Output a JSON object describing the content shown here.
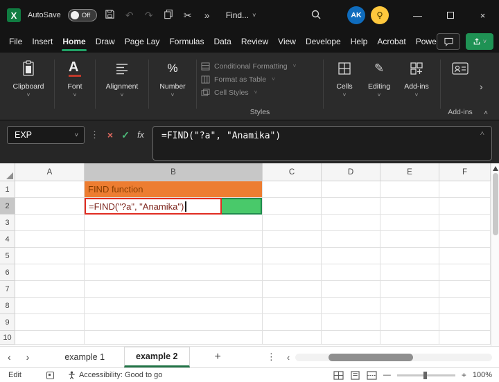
{
  "glyphs": {
    "chevron_down": "˅",
    "chevron_up": "˄",
    "chevron_left": "‹",
    "chevron_right": "›",
    "more": "»",
    "ellipsis_vertical": "⋮",
    "close": "×",
    "check": "✓",
    "minus": "—",
    "plus": "+",
    "undo": "↶",
    "redo": "↷",
    "cut": "✂",
    "pencil": "✎"
  },
  "titlebar": {
    "autosave_label": "AutoSave",
    "autosave_state": "Off",
    "find_label": "Find...",
    "avatar_initials": "AK"
  },
  "menu": {
    "tabs": [
      {
        "label": "File",
        "active": false
      },
      {
        "label": "Insert",
        "active": false
      },
      {
        "label": "Home",
        "active": true
      },
      {
        "label": "Draw",
        "active": false
      },
      {
        "label": "Page Lay",
        "active": false
      },
      {
        "label": "Formulas",
        "active": false
      },
      {
        "label": "Data",
        "active": false
      },
      {
        "label": "Review",
        "active": false
      },
      {
        "label": "View",
        "active": false
      },
      {
        "label": "Develope",
        "active": false
      },
      {
        "label": "Help",
        "active": false
      },
      {
        "label": "Acrobat",
        "active": false
      },
      {
        "label": "Power Piv",
        "active": false
      }
    ]
  },
  "ribbon": {
    "groups": {
      "clipboard": "Clipboard",
      "font": "Font",
      "alignment": "Alignment",
      "number": "Number",
      "cells": "Cells",
      "editing": "Editing",
      "addins": "Add-ins"
    },
    "styles_menu": [
      "Conditional Formatting",
      "Format as Table",
      "Cell Styles"
    ],
    "styles_group_label": "Styles",
    "addins_group_label": "Add-ins"
  },
  "formula_bar": {
    "name_box_value": "EXP",
    "fx_label": "fx",
    "formula": "=FIND(\"?a\", \"Anamika\")"
  },
  "grid": {
    "columns": [
      "A",
      "B",
      "C",
      "D",
      "E",
      "F"
    ],
    "rows": [
      "1",
      "2",
      "3",
      "4",
      "5",
      "6",
      "7",
      "8",
      "9",
      "10"
    ],
    "selected_column": "B",
    "selected_row": "2",
    "cells": {
      "b1": {
        "text": "FIND function",
        "bg": "#ED7D31"
      },
      "b2": {
        "text": "=FIND(\"?a\", \"Anamika\")",
        "fill": "#49C96A",
        "annotation_border": "#E02B20"
      }
    }
  },
  "sheet_tabs": {
    "tabs": [
      {
        "label": "example 1",
        "active": false
      },
      {
        "label": "example 2",
        "active": true
      }
    ]
  },
  "status_bar": {
    "mode": "Edit",
    "accessibility": "Accessibility: Good to go",
    "zoom": "100%"
  },
  "colors": {
    "excel_green": "#217346",
    "accent_green": "#21A366",
    "orange_fill": "#ED7D31",
    "green_fill": "#49C96A",
    "annotation_red": "#E02B20",
    "avatar_blue": "#0F6CBD"
  }
}
